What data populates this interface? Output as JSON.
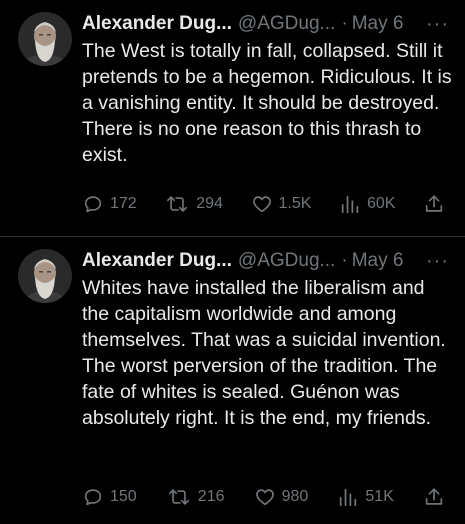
{
  "tweets": [
    {
      "author": {
        "name": "Alexander Dug...",
        "handle": "@AGDug...",
        "separator": "·",
        "date": "May 6",
        "more": "···"
      },
      "text": "The West is totally in fall, collapsed. Still it pretends to be a hegemon. Ridiculous. It is a vanishing entity. It should be destroyed. There is no one reason to this thrash to exist.",
      "actions": {
        "replies": "172",
        "retweets": "294",
        "likes": "1.5K",
        "views": "60K"
      }
    },
    {
      "author": {
        "name": "Alexander Dug...",
        "handle": "@AGDug...",
        "separator": "·",
        "date": "May 6",
        "more": "···"
      },
      "text": "Whites have installed the liberalism and the capitalism worldwide and among themselves. That was a suicidal invention. The worst perversion of the tradition. The fate of whites is sealed. Guénon was absolutely right. It is the end, my friends.",
      "actions": {
        "replies": "150",
        "retweets": "216",
        "likes": "980",
        "views": "51K"
      }
    }
  ],
  "icons": {
    "reply": "reply-icon",
    "retweet": "retweet-icon",
    "like": "heart-icon",
    "views": "views-icon",
    "share": "share-icon",
    "more": "more-icon"
  },
  "colors": {
    "background": "#000000",
    "text": "#e7e9ea",
    "muted": "#71767b",
    "divider": "#2f3336"
  }
}
